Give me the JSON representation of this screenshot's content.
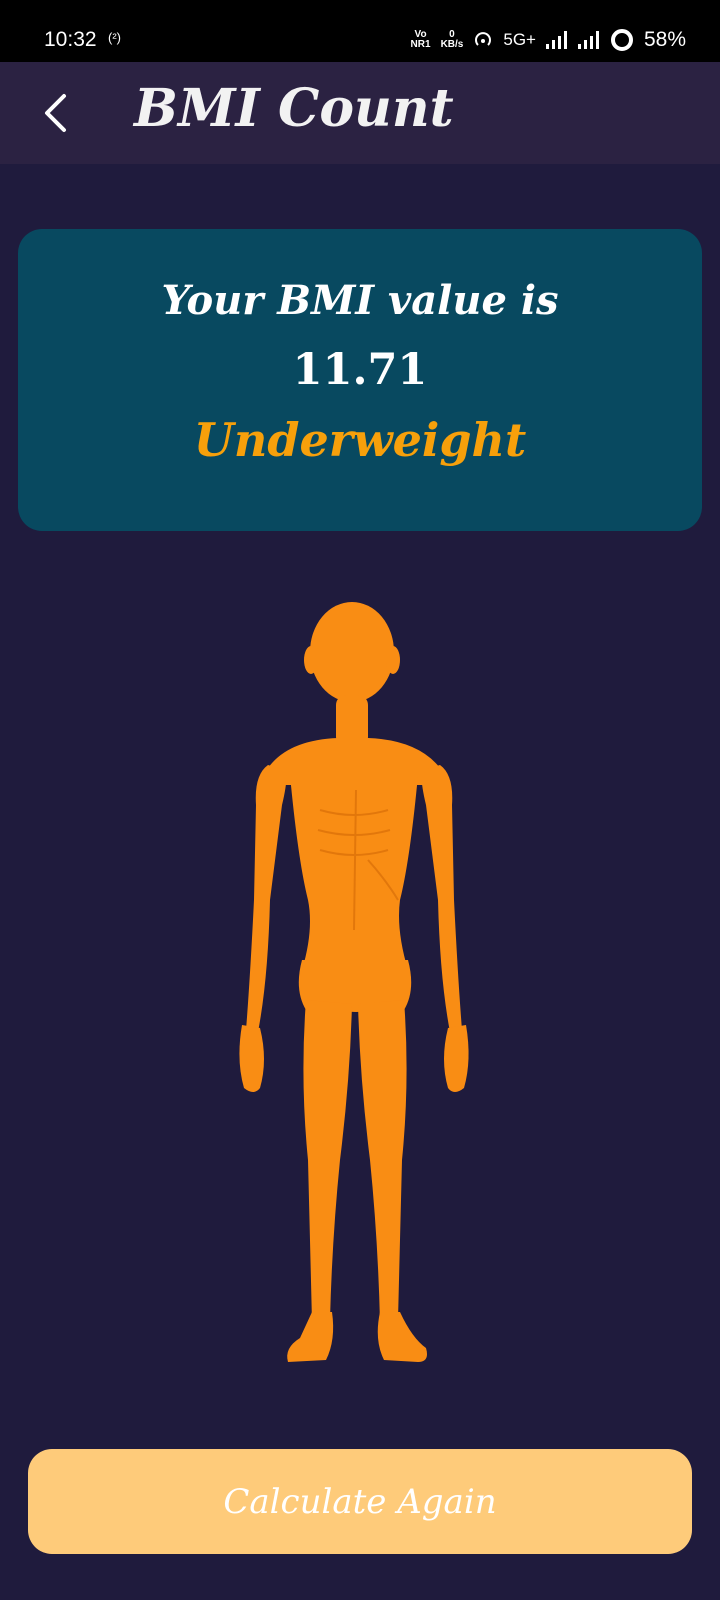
{
  "status_bar": {
    "time": "10:32",
    "cast_indicator": "(²)",
    "volte_top": "Vo",
    "volte_bottom": "NR1",
    "speed_top": "0",
    "speed_bottom": "KB/s",
    "network": "5G+",
    "battery": "58%",
    "icons": [
      "hotspot-icon",
      "signal-icon",
      "signal-icon",
      "battery-ring-icon"
    ]
  },
  "app_bar": {
    "title": "BMI Count",
    "back_icon": "chevron-left-icon"
  },
  "result": {
    "label": "Your BMI value is",
    "value": "11.71",
    "category": "Underweight"
  },
  "illustration": {
    "icon": "underweight-body-figure",
    "color": "#f98d14"
  },
  "actions": {
    "calculate_again": "Calculate Again"
  },
  "colors": {
    "background": "#1f1b3d",
    "app_bar": "#2b2242",
    "card": "#084960",
    "category_text": "#f7a00b",
    "button": "#fecb7a"
  }
}
